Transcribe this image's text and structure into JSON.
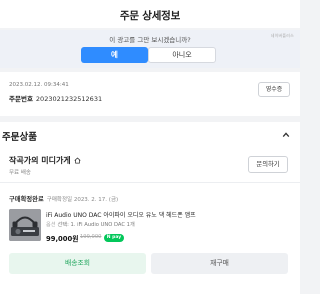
{
  "header": {
    "title": "주문 상세정보"
  },
  "ad_survey": {
    "question": "이 광고를 그만 보시겠습니까?",
    "tag": "네이버플러스",
    "yes_label": "예",
    "no_label": "아니오"
  },
  "order": {
    "datetime": "2023.02.12. 09:34:41",
    "number_label": "주문번호",
    "number_value": "2023021232512631",
    "receipt_label": "영수증"
  },
  "section": {
    "title": "주문상품",
    "chevron_icon": "chevron-up-icon"
  },
  "store": {
    "name": "작곡가의 미디가게",
    "home_icon": "home-icon",
    "shipping": "무료 배송",
    "inquiry_label": "문의하기"
  },
  "product": {
    "status": "구매확정완료",
    "status_date": "구매확정일 2023. 2. 17. (금)",
    "name": "iFi Audio UNO DAC 아이파이 오디오 유노 댁 헤드폰 앰프",
    "option_label": "옵션",
    "option_value": "선택: 1. iFi Audio UNO DAC",
    "quantity": "1개",
    "price": "99,000원",
    "original_price": "199,000",
    "pay_badge": "N pay",
    "track_label": "배송조회",
    "rebuy_label": "재구매"
  },
  "colors": {
    "primary": "#2f8cff",
    "naver_green": "#03c75a",
    "track_text": "#20a65d"
  }
}
